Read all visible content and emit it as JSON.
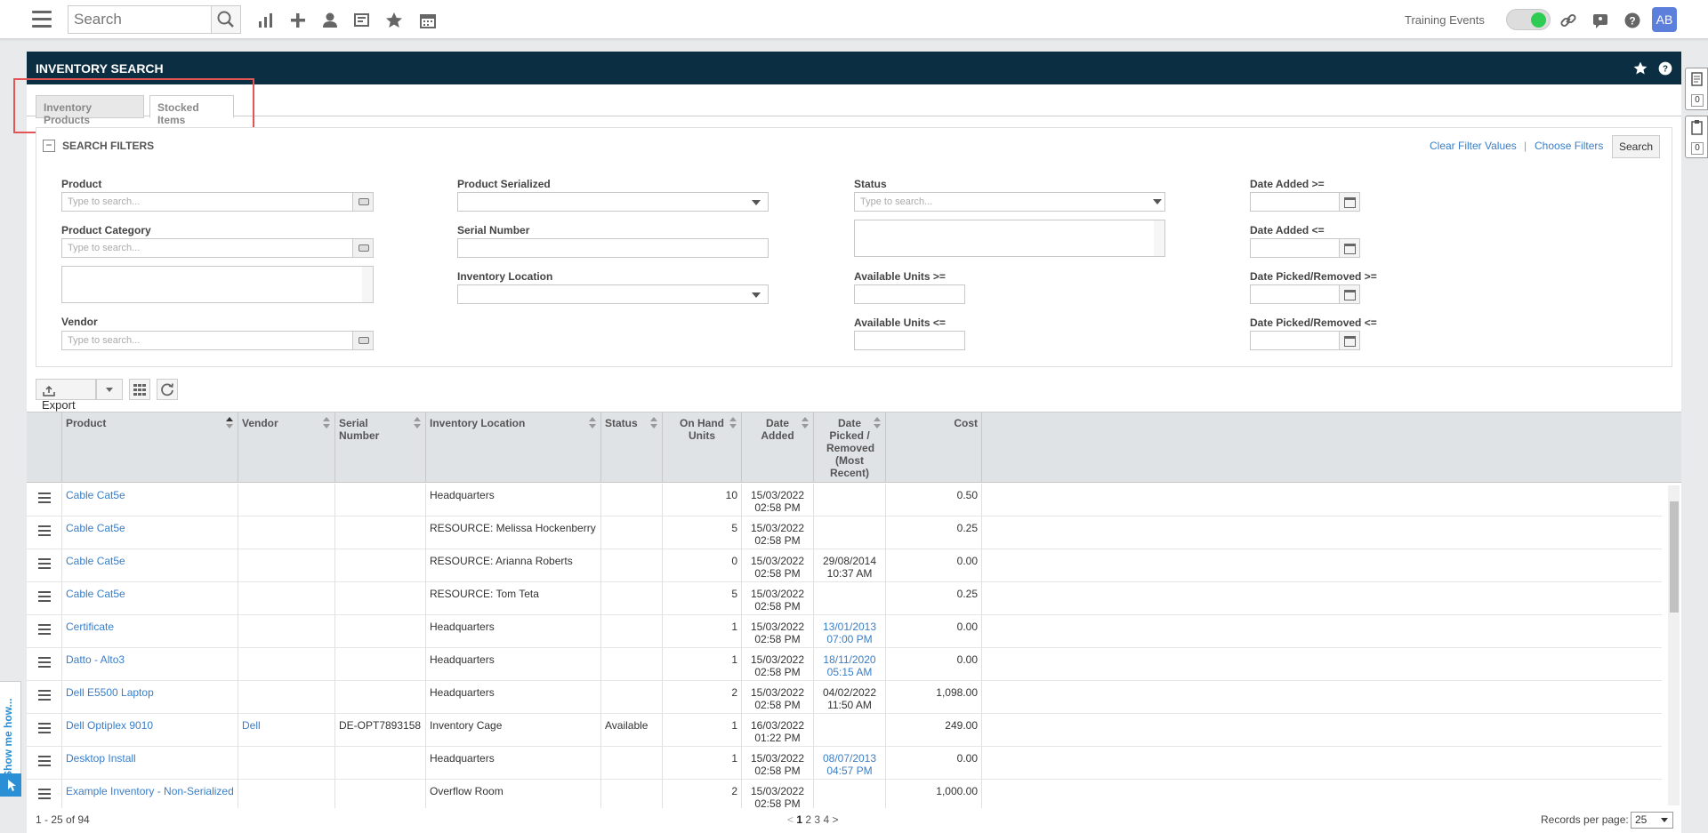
{
  "topbar": {
    "search_placeholder": "Search",
    "training_label": "Training Events",
    "avatar_initials": "AB",
    "toggle_on": true,
    "icons": [
      "chart-icon",
      "plus-icon",
      "user-icon",
      "ticket-icon",
      "star-icon",
      "calendar-icon",
      "link-icon",
      "chat-icon",
      "help-icon"
    ]
  },
  "panel": {
    "title": "INVENTORY SEARCH",
    "tabs": [
      "Inventory Products",
      "Stocked Items"
    ],
    "active_tab": "Stocked Items"
  },
  "filters": {
    "title": "SEARCH FILTERS",
    "clear_label": "Clear Filter Values",
    "separator": "|",
    "choose_label": "Choose Filters",
    "search_label": "Search",
    "product": {
      "label": "Product",
      "placeholder": "Type to search..."
    },
    "product_category": {
      "label": "Product Category",
      "placeholder": "Type to search..."
    },
    "vendor": {
      "label": "Vendor",
      "placeholder": "Type to search..."
    },
    "product_serialized": {
      "label": "Product Serialized"
    },
    "serial_number": {
      "label": "Serial Number"
    },
    "inventory_location": {
      "label": "Inventory Location"
    },
    "status": {
      "label": "Status",
      "placeholder": "Type to search..."
    },
    "available_ge": {
      "label": "Available Units >="
    },
    "available_le": {
      "label": "Available Units <="
    },
    "date_added_ge": {
      "label": "Date Added >="
    },
    "date_added_le": {
      "label": "Date Added <="
    },
    "date_picked_ge": {
      "label": "Date Picked/Removed >="
    },
    "date_picked_le": {
      "label": "Date Picked/Removed <="
    }
  },
  "toolbar": {
    "export_label": "Export"
  },
  "grid": {
    "columns": [
      "Product",
      "Vendor",
      "Serial Number",
      "Inventory Location",
      "Status",
      "On Hand Units",
      "Date Added",
      "Date Picked / Removed (Most Recent)",
      "Cost"
    ],
    "rows": [
      {
        "product": "Cable Cat5e",
        "vendor": "",
        "serial": "",
        "location": "Headquarters",
        "status": "",
        "onhand": "10",
        "added1": "15/03/2022",
        "added2": "02:58 PM",
        "picked1": "",
        "picked2": "",
        "picked_link": false,
        "cost": "0.50"
      },
      {
        "product": "Cable Cat5e",
        "vendor": "",
        "serial": "",
        "location": "RESOURCE: Melissa Hockenberry",
        "status": "",
        "onhand": "5",
        "added1": "15/03/2022",
        "added2": "02:58 PM",
        "picked1": "",
        "picked2": "",
        "picked_link": false,
        "cost": "0.25"
      },
      {
        "product": "Cable Cat5e",
        "vendor": "",
        "serial": "",
        "location": "RESOURCE: Arianna Roberts",
        "status": "",
        "onhand": "0",
        "added1": "15/03/2022",
        "added2": "02:58 PM",
        "picked1": "29/08/2014",
        "picked2": "10:37 AM",
        "picked_link": false,
        "cost": "0.00"
      },
      {
        "product": "Cable Cat5e",
        "vendor": "",
        "serial": "",
        "location": "RESOURCE: Tom Teta",
        "status": "",
        "onhand": "5",
        "added1": "15/03/2022",
        "added2": "02:58 PM",
        "picked1": "",
        "picked2": "",
        "picked_link": false,
        "cost": "0.25"
      },
      {
        "product": "Certificate",
        "vendor": "",
        "serial": "",
        "location": "Headquarters",
        "status": "",
        "onhand": "1",
        "added1": "15/03/2022",
        "added2": "02:58 PM",
        "picked1": "13/01/2013",
        "picked2": "07:00 PM",
        "picked_link": true,
        "cost": "0.00"
      },
      {
        "product": "Datto - Alto3",
        "vendor": "",
        "serial": "",
        "location": "Headquarters",
        "status": "",
        "onhand": "1",
        "added1": "15/03/2022",
        "added2": "02:58 PM",
        "picked1": "18/11/2020",
        "picked2": "05:15 AM",
        "picked_link": true,
        "cost": "0.00"
      },
      {
        "product": "Dell E5500 Laptop",
        "vendor": "",
        "serial": "",
        "location": "Headquarters",
        "status": "",
        "onhand": "2",
        "added1": "15/03/2022",
        "added2": "02:58 PM",
        "picked1": "04/02/2022",
        "picked2": "11:50 AM",
        "picked_link": false,
        "cost": "1,098.00"
      },
      {
        "product": "Dell Optiplex 9010",
        "vendor": "Dell",
        "serial": "DE-OPT7893158",
        "location": "Inventory Cage",
        "status": "Available",
        "onhand": "1",
        "added1": "16/03/2022",
        "added2": "01:22 PM",
        "picked1": "",
        "picked2": "",
        "picked_link": false,
        "cost": "249.00"
      },
      {
        "product": "Desktop Install",
        "vendor": "",
        "serial": "",
        "location": "Headquarters",
        "status": "",
        "onhand": "1",
        "added1": "15/03/2022",
        "added2": "02:58 PM",
        "picked1": "08/07/2013",
        "picked2": "04:57 PM",
        "picked_link": true,
        "cost": "0.00"
      },
      {
        "product": "Example Inventory - Non-Serialized",
        "vendor": "",
        "serial": "",
        "location": "Overflow Room",
        "status": "",
        "onhand": "2",
        "added1": "15/03/2022",
        "added2": "02:58 PM",
        "picked1": "",
        "picked2": "",
        "picked_link": false,
        "cost": "1,000.00"
      }
    ]
  },
  "footer": {
    "range": "1 - 25 of 94",
    "prev": "<",
    "pages": [
      "1",
      "2",
      "3",
      "4"
    ],
    "next": ">",
    "records_label": "Records per page:",
    "records_value": "25"
  },
  "side": {
    "show_me": "Show me how...",
    "count1": "0",
    "count2": "0"
  }
}
